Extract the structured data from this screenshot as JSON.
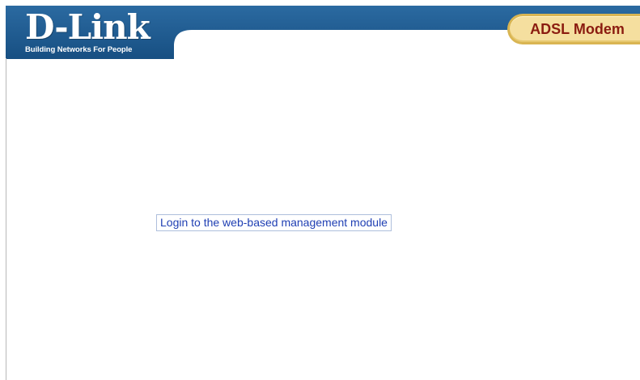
{
  "header": {
    "brand": {
      "logo_text": "D-Link",
      "tagline": "Building Networks For People"
    },
    "product_badge": "ADSL Modem",
    "colors": {
      "banner": "#1f5a8c",
      "badge_fill": "#f5df9f",
      "badge_border": "#d9b552",
      "badge_text": "#8b1c10"
    }
  },
  "main": {
    "login_link": {
      "label": "Login to the web-based management module",
      "color": "#1f3fb3"
    }
  }
}
